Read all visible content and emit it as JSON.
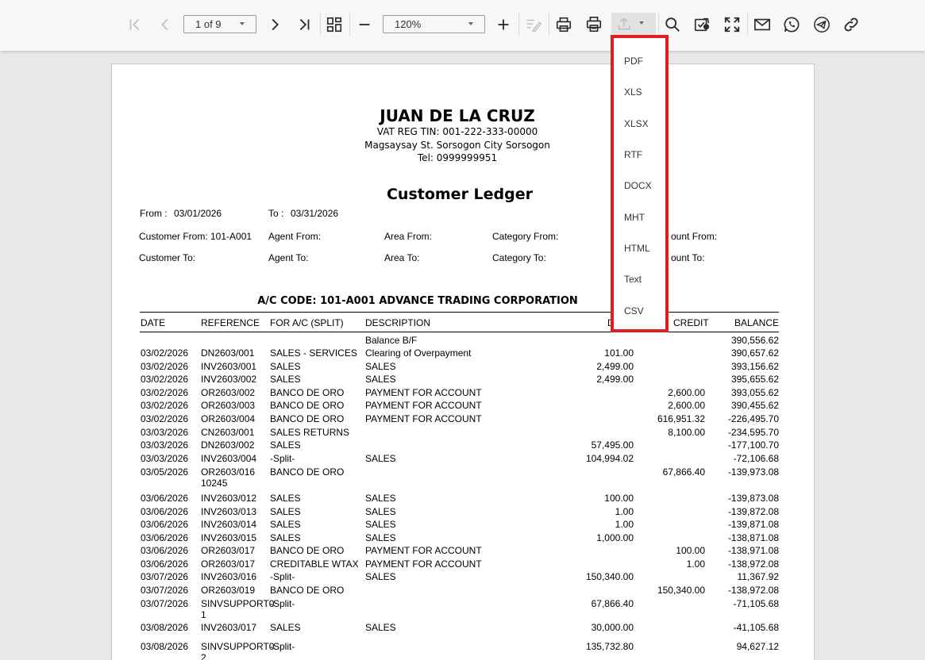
{
  "toolbar": {
    "page_indicator": "1 of 9",
    "zoom": "120%",
    "buttons": [
      "first-page",
      "previous-page",
      "next-page",
      "last-page",
      "multi-page-view",
      "zoom-out",
      "zoom-in",
      "editing-fields",
      "print",
      "print-page",
      "export",
      "search",
      "toggle-parameters",
      "full-screen",
      "send-email",
      "share-whatsapp",
      "share-telegram",
      "copy-link"
    ]
  },
  "export_menu": {
    "items": [
      "PDF",
      "XLS",
      "XLSX",
      "RTF",
      "DOCX",
      "MHT",
      "HTML",
      "Text",
      "CSV"
    ],
    "highlight_color": "#e11d24"
  },
  "report": {
    "company": "JUAN DE LA CRUZ",
    "vat": "VAT REG TIN: 001-222-333-00000",
    "address": "Magsaysay St. Sorsogon City Sorsogon",
    "tel": "Tel: 0999999951",
    "title": "Customer Ledger",
    "from_label": "From :",
    "from_value": "03/01/2026",
    "to_label": "To :",
    "to_value": "03/31/2026",
    "filters_row1": [
      "Customer From:  101-A001",
      "Agent From:",
      "Area From:",
      "Category From:",
      "ount From:"
    ],
    "filters_row2": [
      "Customer To:",
      "Agent To:",
      "Area To:",
      "Category To:",
      "ount To:"
    ],
    "account_header": "A/C CODE: 101-A001    ADVANCE TRADING CORPORATION",
    "columns": [
      "DATE",
      "REFERENCE",
      "FOR A/C (SPLIT)",
      "DESCRIPTION",
      "D",
      "CREDIT",
      "BALANCE"
    ],
    "rows": [
      {
        "date": "",
        "ref": "",
        "ref2": "",
        "foracct": "",
        "desc": "Balance B/F",
        "debit": "",
        "credit": "",
        "balance": "390,556.62"
      },
      {
        "date": "03/02/2026",
        "ref": "DN2603/001",
        "ref2": "",
        "foracct": "SALES - SERVICES",
        "desc": "Clearing of Overpayment",
        "debit": "101.00",
        "credit": "",
        "balance": "390,657.62"
      },
      {
        "date": "03/02/2026",
        "ref": "INV2603/001",
        "ref2": "",
        "foracct": "SALES",
        "desc": "SALES",
        "debit": "2,499.00",
        "credit": "",
        "balance": "393,156.62"
      },
      {
        "date": "03/02/2026",
        "ref": "INV2603/002",
        "ref2": "",
        "foracct": "SALES",
        "desc": "SALES",
        "debit": "2,499.00",
        "credit": "",
        "balance": "395,655.62"
      },
      {
        "date": "03/02/2026",
        "ref": "OR2603/002",
        "ref2": "",
        "foracct": "BANCO DE ORO",
        "desc": "PAYMENT FOR ACCOUNT",
        "debit": "",
        "credit": "2,600.00",
        "balance": "393,055.62"
      },
      {
        "date": "03/02/2026",
        "ref": "OR2603/003",
        "ref2": "",
        "foracct": "BANCO DE ORO",
        "desc": "PAYMENT FOR ACCOUNT",
        "debit": "",
        "credit": "2,600.00",
        "balance": "390,455.62"
      },
      {
        "date": "03/02/2026",
        "ref": "OR2603/004",
        "ref2": "",
        "foracct": "BANCO DE ORO",
        "desc": "PAYMENT FOR ACCOUNT",
        "debit": "",
        "credit": "616,951.32",
        "balance": "-226,495.70"
      },
      {
        "date": "03/03/2026",
        "ref": "CN2603/001",
        "ref2": "",
        "foracct": "SALES RETURNS",
        "desc": "",
        "debit": "",
        "credit": "8,100.00",
        "balance": "-234,595.70"
      },
      {
        "date": "03/03/2026",
        "ref": "DN2603/002",
        "ref2": "",
        "foracct": "SALES",
        "desc": "",
        "debit": "57,495.00",
        "credit": "",
        "balance": "-177,100.70"
      },
      {
        "date": "03/03/2026",
        "ref": "INV2603/004",
        "ref2": "",
        "foracct": "-Split-",
        "desc": "SALES",
        "debit": "104,994.02",
        "credit": "",
        "balance": "-72,106.68"
      },
      {
        "date": "03/05/2026",
        "ref": "OR2603/016",
        "ref2": "10245",
        "foracct": "BANCO DE ORO",
        "desc": "",
        "debit": "",
        "credit": "67,866.40",
        "balance": "-139,973.08"
      },
      {
        "date": "03/06/2026",
        "ref": "INV2603/012",
        "ref2": "",
        "foracct": "SALES",
        "desc": "SALES",
        "debit": "100.00",
        "credit": "",
        "balance": "-139,873.08"
      },
      {
        "date": "03/06/2026",
        "ref": "INV2603/013",
        "ref2": "",
        "foracct": "SALES",
        "desc": "SALES",
        "debit": "1.00",
        "credit": "",
        "balance": "-139,872.08"
      },
      {
        "date": "03/06/2026",
        "ref": "INV2603/014",
        "ref2": "",
        "foracct": "SALES",
        "desc": "SALES",
        "debit": "1.00",
        "credit": "",
        "balance": "-139,871.08"
      },
      {
        "date": "03/06/2026",
        "ref": "INV2603/015",
        "ref2": "",
        "foracct": "SALES",
        "desc": "SALES",
        "debit": "1,000.00",
        "credit": "",
        "balance": "-138,871.08"
      },
      {
        "date": "03/06/2026",
        "ref": "OR2603/017",
        "ref2": "",
        "foracct": "BANCO DE ORO",
        "desc": "PAYMENT FOR ACCOUNT",
        "debit": "",
        "credit": "100.00",
        "balance": "-138,971.08"
      },
      {
        "date": "03/06/2026",
        "ref": "OR2603/017",
        "ref2": "",
        "foracct": "CREDITABLE WTAX",
        "desc": "PAYMENT FOR ACCOUNT",
        "debit": "",
        "credit": "1.00",
        "balance": "-138,972.08"
      },
      {
        "date": "03/07/2026",
        "ref": "INV2603/016",
        "ref2": "",
        "foracct": "-Split-",
        "desc": "SALES",
        "debit": "150,340.00",
        "credit": "",
        "balance": "11,367.92"
      },
      {
        "date": "03/07/2026",
        "ref": "OR2603/019",
        "ref2": "",
        "foracct": "BANCO DE ORO",
        "desc": "",
        "debit": "",
        "credit": "150,340.00",
        "balance": "-138,972.08"
      },
      {
        "date": "03/07/2026",
        "ref": "SINVSUPPORT0",
        "ref2": "1",
        "foracct": "-Split-",
        "desc": "",
        "debit": "67,866.40",
        "credit": "",
        "balance": "-71,105.68"
      },
      {
        "date": "03/08/2026",
        "ref": "INV2603/017",
        "ref2": "",
        "foracct": "SALES",
        "desc": "SALES",
        "debit": "30,000.00",
        "credit": "",
        "balance": "-41,105.68"
      },
      {
        "date": "03/08/2026",
        "ref": "SINVSUPPORT0",
        "ref2": "2",
        "foracct": "-Split-",
        "desc": "",
        "debit": "135,732.80",
        "credit": "",
        "balance": "94,627.12"
      }
    ]
  }
}
